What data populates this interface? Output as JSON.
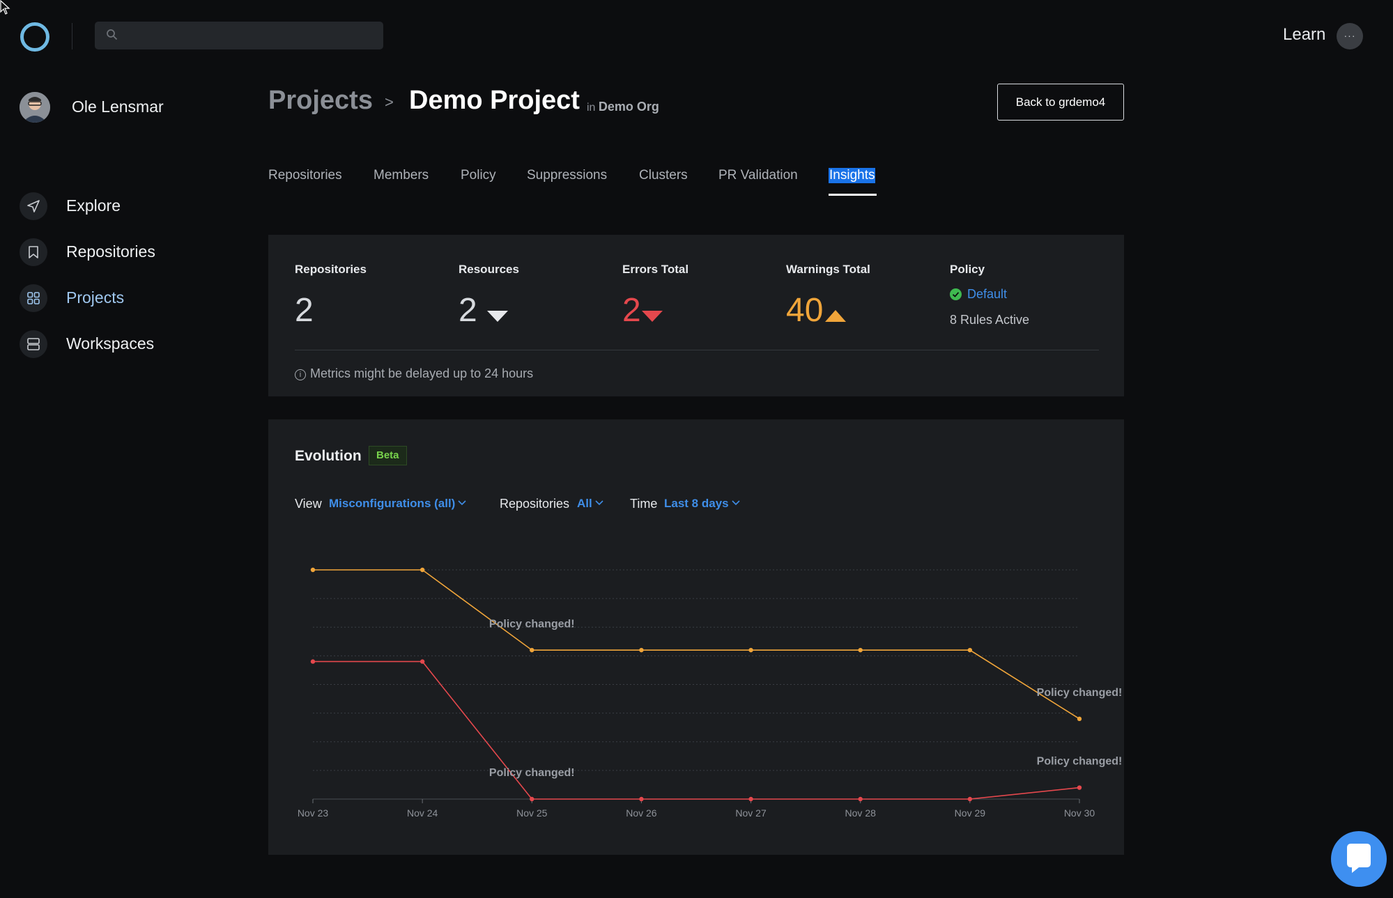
{
  "header": {
    "learn_label": "Learn",
    "more_label": "···"
  },
  "sidebar": {
    "user_name": "Ole Lensmar",
    "items": [
      {
        "label": "Explore",
        "icon": "send-icon",
        "active": false
      },
      {
        "label": "Repositories",
        "icon": "bookmark-icon",
        "active": false
      },
      {
        "label": "Projects",
        "icon": "grid-icon",
        "active": true
      },
      {
        "label": "Workspaces",
        "icon": "stack-icon",
        "active": false
      }
    ]
  },
  "breadcrumb": {
    "projects": "Projects",
    "separator": ">",
    "title": "Demo Project",
    "in_prefix": "in",
    "org": "Demo Org"
  },
  "back_button": "Back to grdemo4",
  "tabs": [
    "Repositories",
    "Members",
    "Policy",
    "Suppressions",
    "Clusters",
    "PR Validation",
    "Insights"
  ],
  "active_tab": "Insights",
  "metrics": {
    "repositories": {
      "label": "Repositories",
      "value": "2"
    },
    "resources": {
      "label": "Resources",
      "value": "2",
      "trend": "down"
    },
    "errors": {
      "label": "Errors Total",
      "value": "2",
      "trend": "down",
      "color": "#e5484d"
    },
    "warnings": {
      "label": "Warnings Total",
      "value": "40",
      "trend": "up",
      "color": "#f0a53a"
    },
    "policy": {
      "label": "Policy",
      "name": "Default",
      "rules": "8 Rules Active"
    },
    "note": "Metrics might be delayed up to 24 hours"
  },
  "evolution": {
    "title": "Evolution",
    "badge": "Beta",
    "filters": {
      "view_label": "View",
      "view_value": "Misconfigurations (all)",
      "repos_label": "Repositories",
      "repos_value": "All",
      "time_label": "Time",
      "time_value": "Last 8 days"
    }
  },
  "chart_data": {
    "type": "line",
    "x": [
      "Nov 23",
      "Nov 24",
      "Nov 25",
      "Nov 26",
      "Nov 27",
      "Nov 28",
      "Nov 29",
      "Nov 30"
    ],
    "series": [
      {
        "color": "#f0a53a",
        "values": [
          80,
          80,
          52,
          52,
          52,
          52,
          52,
          28
        ]
      },
      {
        "color": "#e5484d",
        "values": [
          48,
          48,
          0,
          0,
          0,
          0,
          0,
          4
        ]
      }
    ],
    "ylim": [
      0,
      80
    ],
    "grid": true,
    "annotations": [
      {
        "text": "Policy changed!",
        "x": "Nov 25",
        "y": 60
      },
      {
        "text": "Policy changed!",
        "x": "Nov 25",
        "y": 8
      },
      {
        "text": "Policy changed!",
        "x": "Nov 30",
        "y": 36
      },
      {
        "text": "Policy changed!",
        "x": "Nov 30",
        "y": 12
      }
    ]
  }
}
